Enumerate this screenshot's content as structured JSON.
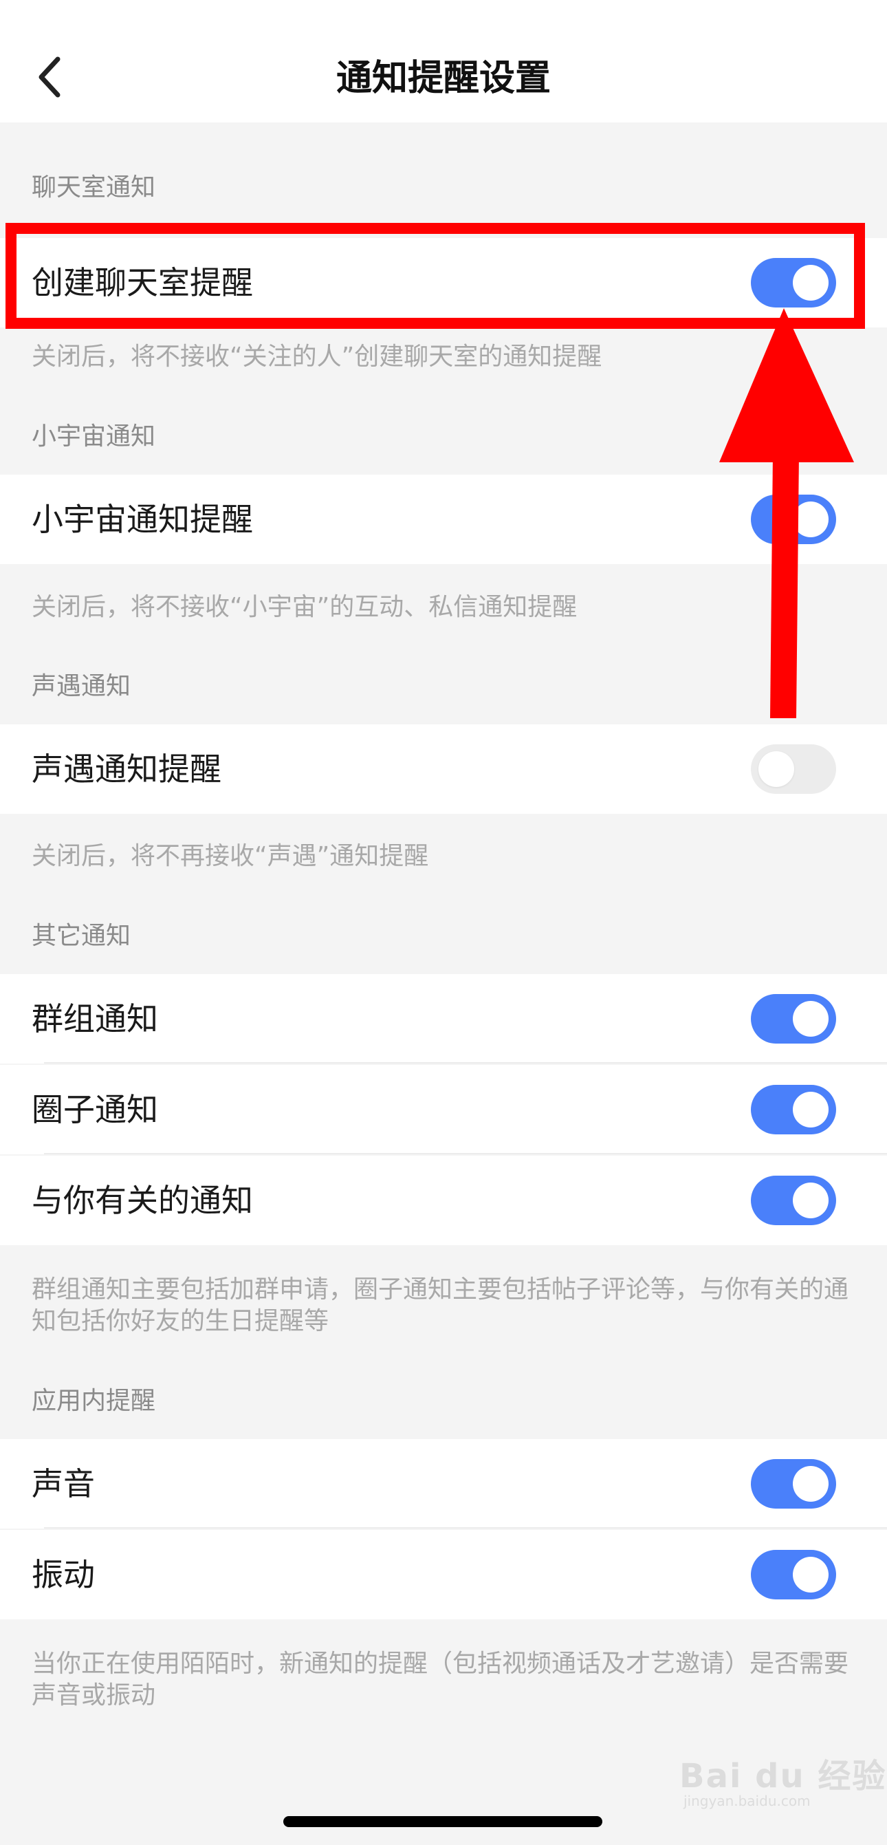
{
  "header": {
    "title": "通知提醒设置"
  },
  "sections": [
    {
      "label": "聊天室通知",
      "rows": [
        {
          "label": "创建聊天室提醒",
          "on": true
        }
      ],
      "note": "关闭后，将不接收“关注的人”创建聊天室的通知提醒"
    },
    {
      "label": "小宇宙通知",
      "rows": [
        {
          "label": "小宇宙通知提醒",
          "on": true
        }
      ],
      "note": "关闭后，将不接收“小宇宙”的互动、私信通知提醒"
    },
    {
      "label": "声遇通知",
      "rows": [
        {
          "label": "声遇通知提醒",
          "on": false
        }
      ],
      "note": "关闭后，将不再接收“声遇”通知提醒"
    },
    {
      "label": "其它通知",
      "rows": [
        {
          "label": "群组通知",
          "on": true
        },
        {
          "label": "圈子通知",
          "on": true
        },
        {
          "label": "与你有关的通知",
          "on": true
        }
      ],
      "note": "群组通知主要包括加群申请，圈子通知主要包括帖子评论等，与你有关的通知包括你好友的生日提醒等"
    },
    {
      "label": "应用内提醒",
      "rows": [
        {
          "label": "声音",
          "on": true
        },
        {
          "label": "振动",
          "on": true
        }
      ],
      "note": "当你正在使用陌陌时，新通知的提醒（包括视频通话及才艺邀请）是否需要声音或振动"
    }
  ],
  "watermark": {
    "brand": "Bai du 经验",
    "sub": "jingyan.baidu.com"
  },
  "colors": {
    "toggle_on": "#4a80fa",
    "toggle_off": "#ececec",
    "highlight": "#ff0000"
  },
  "icons": {
    "back": "chevron-left-icon"
  }
}
